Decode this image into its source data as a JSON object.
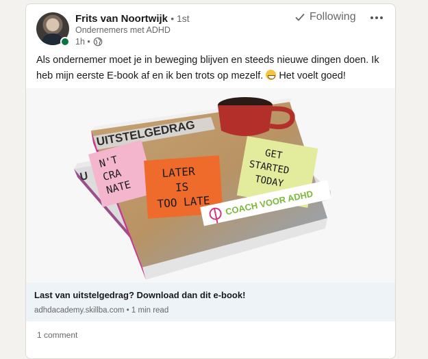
{
  "post": {
    "author": {
      "name": "Frits van Noortwijk",
      "degree": "• 1st",
      "headline": "Ondernemers met ADHD",
      "time": "1h •",
      "online": true
    },
    "follow_button": {
      "icon": "check-icon",
      "label": "Following"
    },
    "more_icon": "ellipsis-icon",
    "text_line1": "Als ondernemer moet je in beweging blijven en steeds nieuwe dingen doen. Ik",
    "text_line2_a": "heb mijn eerste E-book af en ik ben trots op mezelf.",
    "text_line2_b": "Het voelt goed!",
    "emoji": "grinning-face",
    "image": {
      "book_title": "UITSTELGEDRAG",
      "note_pink": [
        "N'T",
        "CRA",
        "NATE"
      ],
      "note_orange": [
        "LATER",
        "IS",
        "TOO LATE"
      ],
      "note_green": [
        "GET",
        "STARTED",
        "TODAY"
      ],
      "back_book_fragment": "U",
      "brand": "COACH VOOR ADHD"
    },
    "link": {
      "title": "Last van uitstelgedrag? Download dan dit e-book!",
      "domain": "adhdacademy.skillba.com",
      "read_time": "• 1 min read"
    },
    "comments": "1 comment"
  },
  "colors": {
    "online_green": "#057642",
    "link_bg": "#eef3f8",
    "page_bg": "#f3f2ef"
  }
}
